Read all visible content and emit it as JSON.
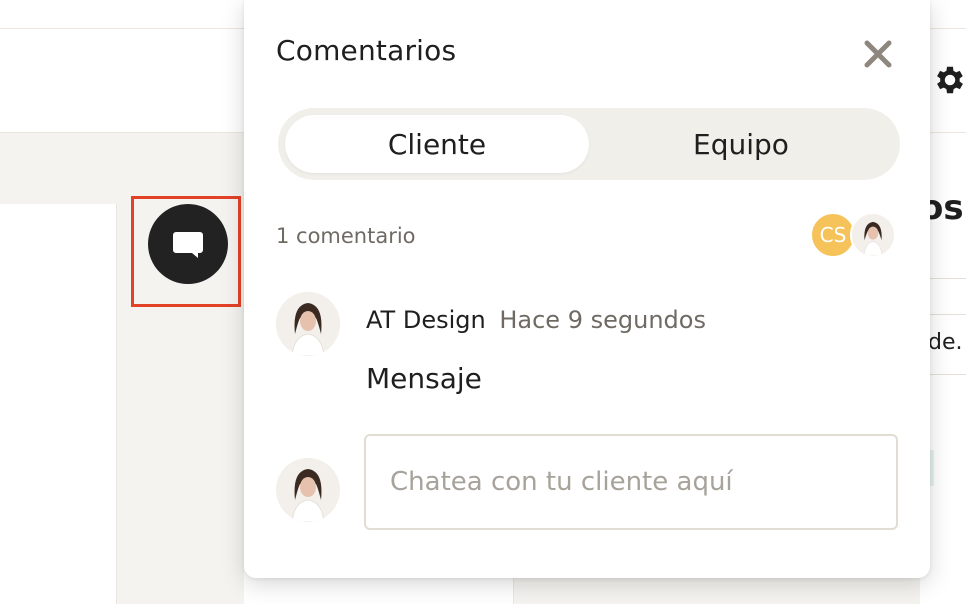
{
  "background": {
    "right_heading_fragment": "os",
    "right_text_fragment": "de.",
    "settings_icon": "gear-icon"
  },
  "trigger": {
    "icon": "comment-bubble-icon",
    "highlight_color": "#e34227"
  },
  "comments_panel": {
    "title": "Comentarios",
    "close_icon": "close-icon",
    "tabs": [
      {
        "label": "Cliente",
        "active": true
      },
      {
        "label": "Equipo",
        "active": false
      }
    ],
    "count_label": "1 comentario",
    "participants": [
      {
        "type": "initials",
        "initials": "CS",
        "color": "#f6c35a"
      },
      {
        "type": "photo",
        "icon": "user-photo-avatar"
      }
    ],
    "comments": [
      {
        "author": "AT Design",
        "time": "Hace 9 segundos",
        "body": "Mensaje",
        "avatar": "user-photo-avatar"
      }
    ],
    "composer": {
      "placeholder": "Chatea con tu cliente aquí",
      "value": ""
    }
  },
  "colors": {
    "page_background": "#f5f3ef",
    "tab_track": "#f1efea",
    "muted_text": "#6f6a63",
    "primary_text": "#1f1f1f"
  }
}
